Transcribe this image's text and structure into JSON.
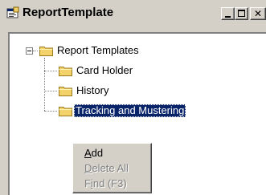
{
  "window": {
    "title": "ReportTemplate",
    "controls": {
      "minimize": "minimize",
      "maximize": "maximize",
      "close": "✕"
    }
  },
  "tree": {
    "root": {
      "label": "Report Templates",
      "icon": "folder-icon",
      "expanded": true
    },
    "children": [
      {
        "label": "Card Holder",
        "icon": "folder-icon",
        "selected": false
      },
      {
        "label": "History",
        "icon": "folder-icon",
        "selected": false
      },
      {
        "label": "Tracking and Mustering",
        "icon": "folder-icon",
        "selected": true
      }
    ]
  },
  "context_menu": {
    "items": [
      {
        "prefix": "",
        "mnemonic": "A",
        "rest": "dd",
        "enabled": true
      },
      {
        "prefix": "",
        "mnemonic": "D",
        "rest": "elete All",
        "enabled": false
      },
      {
        "prefix": "F",
        "mnemonic": "i",
        "rest": "nd (F3)",
        "enabled": false
      }
    ]
  },
  "colors": {
    "face": "#d4d0c8",
    "selection": "#0a246a",
    "folder": "#f4d26b",
    "disabled_text": "#808080"
  }
}
